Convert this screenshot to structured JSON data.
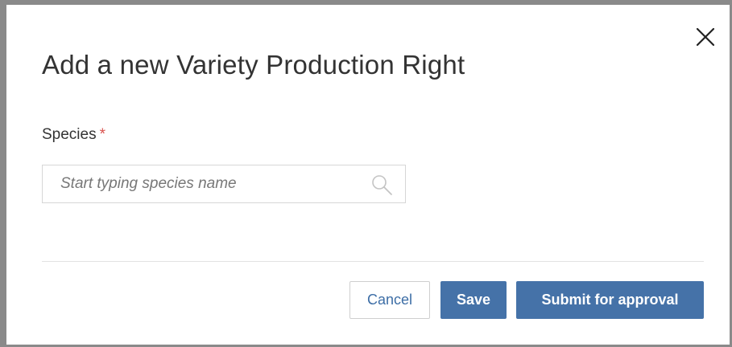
{
  "modal": {
    "title": "Add a new Variety Production Right",
    "close_icon": "close-icon"
  },
  "species_field": {
    "label": "Species",
    "required_marker": "*",
    "placeholder": "Start typing species name",
    "value": "",
    "icon": "search-icon"
  },
  "footer": {
    "cancel_label": "Cancel",
    "save_label": "Save",
    "submit_label": "Submit for approval"
  },
  "colors": {
    "primary": "#4572a8",
    "required": "#d9534f",
    "text": "#333333",
    "overlay": "#8a8a8a"
  }
}
